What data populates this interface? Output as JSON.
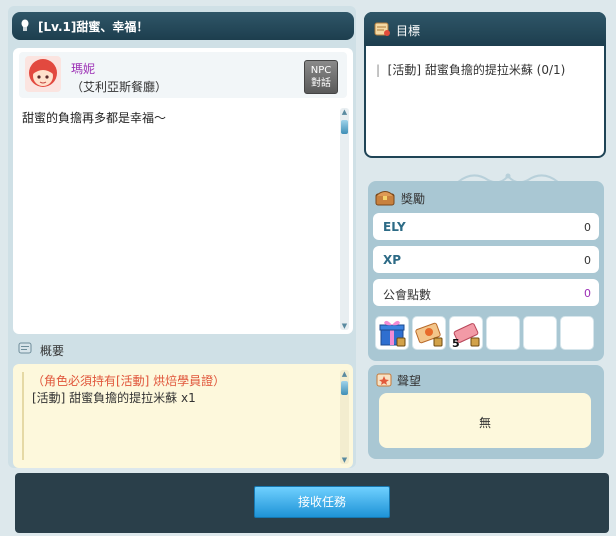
{
  "title_bar": {
    "title": "[Lv.1]甜蜜、幸福！"
  },
  "npc": {
    "name": "瑪妮",
    "location": "（艾利亞斯餐廳）",
    "talk_button_line1": "NPC",
    "talk_button_line2": "對話"
  },
  "dialog": {
    "text": "甜蜜的負擔再多都是幸福～"
  },
  "summary": {
    "label": "概要",
    "required": "（角色必須持有[活動] 烘焙學員證）",
    "item": "[活動] 甜蜜負擔的提拉米蘇 x1"
  },
  "goal": {
    "title": "目標",
    "item": "[活動] 甜蜜負擔的提拉米蘇 (0/1)"
  },
  "reward": {
    "title": "獎勵",
    "rows": [
      {
        "label": "ELY",
        "value": "0"
      },
      {
        "label": "XP",
        "value": "0"
      },
      {
        "label": "公會點數",
        "value": "0"
      }
    ],
    "slot_count": "5"
  },
  "reputation": {
    "title": "聲望",
    "value": "無"
  },
  "accept_button": "接收任務",
  "colors": {
    "header": "#1d3e4e",
    "panel": "#a9c7d3",
    "guild_points": "#9c2fb5",
    "required_text": "#e0553a",
    "button": "#1e93d6"
  }
}
